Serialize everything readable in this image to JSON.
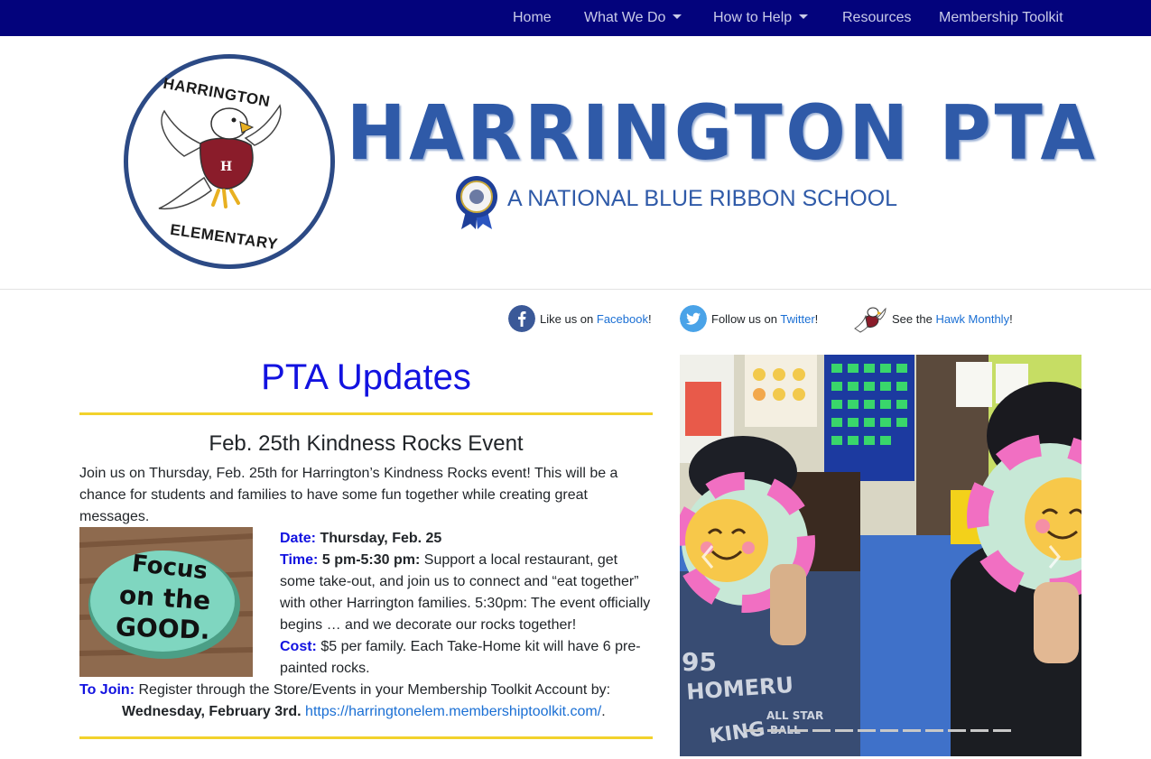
{
  "nav": {
    "home": "Home",
    "what_we_do": "What We Do",
    "how_to_help": "How to Help",
    "resources": "Resources",
    "membership_toolkit": "Membership Toolkit"
  },
  "banner": {
    "logo_top_text": "HARRINGTON",
    "logo_bottom_text": "ELEMENTARY",
    "title": "HARRINGTON PTA",
    "subtitle": "A NATIONAL BLUE RIBBON SCHOOL"
  },
  "social": {
    "facebook_prefix": "Like us on ",
    "facebook_link": "Facebook",
    "facebook_suffix": "!",
    "twitter_prefix": "Follow us on ",
    "twitter_link": "Twitter",
    "twitter_suffix": "!",
    "hawk_prefix": "See the ",
    "hawk_link": "Hawk Monthly",
    "hawk_suffix": "!"
  },
  "updates": {
    "heading": "PTA Updates",
    "event_title": "Feb. 25th Kindness Rocks Event",
    "intro": "Join us on Thursday, Feb. 25th for Harrington’s Kindness Rocks event! This will be a chance for students and families to have some fun together while creating great messages.",
    "rock_text_1": "Focus",
    "rock_text_2": "on the",
    "rock_text_3": "GOOD.",
    "date_label": "Date:",
    "date_value": "Thursday, Feb. 25",
    "time_label": "Time:",
    "time_value": "5 pm-5:30 pm:",
    "time_desc": "Support a local restaurant, get some take-out, and join us to connect and “eat together” with other Harrington families. 5:30pm: The event officially begins … and we decorate our rocks together!",
    "cost_label": "Cost:",
    "cost_desc": "$5 per family. Each Take-Home kit will have 6 pre-painted rocks.",
    "join_label": "To Join:",
    "join_desc": "Register through the Store/Events in your Membership Toolkit Account by:",
    "join_deadline": "Wednesday, February 3rd.",
    "join_link": "https://harringtonelem.membershiptoolkit.com/",
    "join_suffix": "."
  },
  "carousel": {
    "shirt_text_1": "95",
    "shirt_text_2": "HOMERU",
    "shirt_text_3": "KING",
    "shirt_text_4": "ALL STAR",
    "shirt_text_5": "BALL",
    "indicator_count": 12
  },
  "colors": {
    "nav_bg": "#03037c",
    "heading_blue": "#1212e0",
    "rule_yellow": "#f2d22c",
    "link_blue": "#1a6fd4",
    "title_blue": "#2f5aa8"
  }
}
